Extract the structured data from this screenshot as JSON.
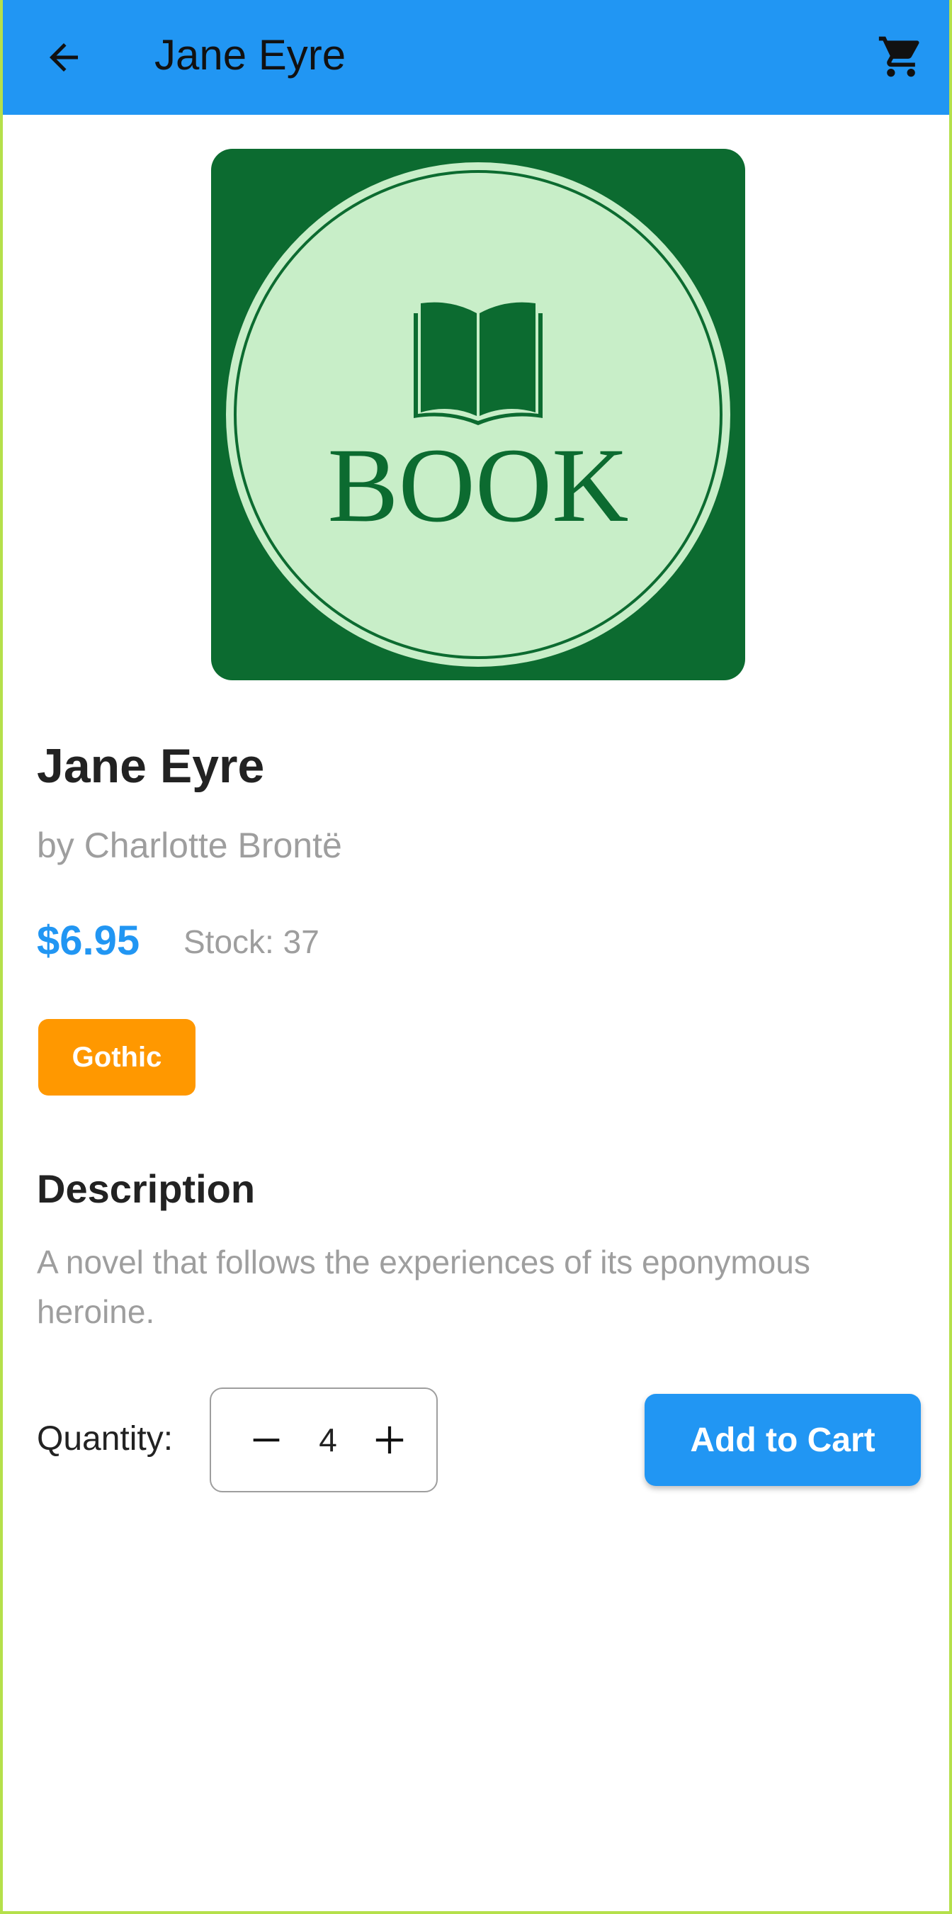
{
  "appbar": {
    "title": "Jane Eyre",
    "back_icon": "arrow-left-icon",
    "cart_icon": "shopping-cart-icon",
    "background": "#2196f3"
  },
  "cover": {
    "text": "BOOK",
    "icon": "open-book-icon",
    "background": "#0c6b30",
    "circle_fill": "#c8eec8"
  },
  "book": {
    "title": "Jane Eyre",
    "author": "by Charlotte Brontë",
    "price": "$6.95",
    "stock": "Stock: 37",
    "genre": "Gothic"
  },
  "description": {
    "heading": "Description",
    "body": "A novel that follows the experiences of its eponymous heroine."
  },
  "purchase": {
    "quantity_label": "Quantity:",
    "quantity": "4",
    "decrement_icon": "minus-icon",
    "increment_icon": "plus-icon",
    "add_to_cart_label": "Add to Cart"
  },
  "colors": {
    "accent": "#2196f3",
    "chip": "#ff9800",
    "muted_text": "#9e9e9e"
  }
}
